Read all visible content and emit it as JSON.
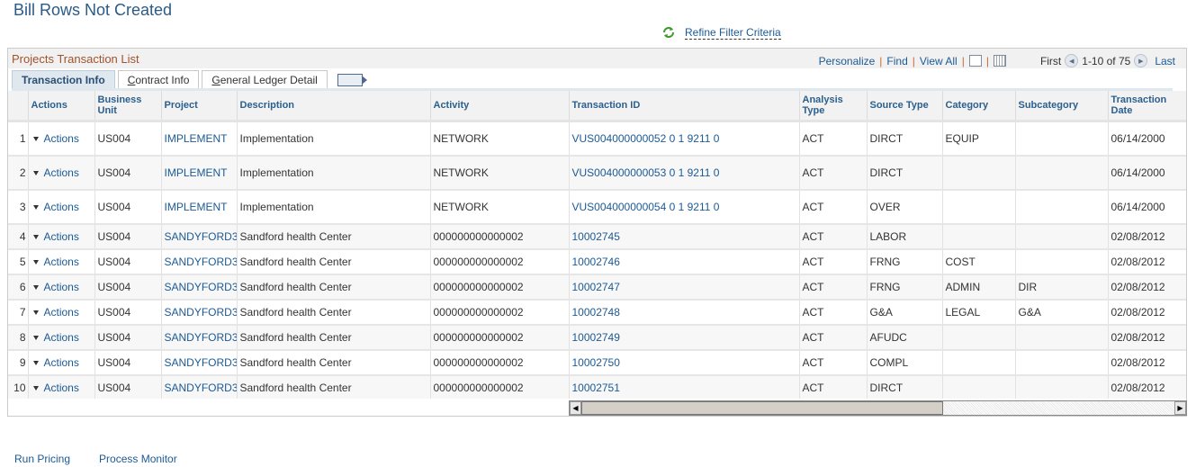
{
  "page": {
    "title": "Bill Rows Not Created"
  },
  "refine": {
    "label": "Refine Filter Criteria",
    "icon": "refresh-icon"
  },
  "grid": {
    "title": "Projects Transaction List",
    "tools": {
      "personalize": "Personalize",
      "find": "Find",
      "view_all": "View All"
    },
    "pager": {
      "first": "First",
      "range": "1-10 of 75",
      "last": "Last"
    },
    "tabs": [
      {
        "label": "Transaction Info",
        "active": true
      },
      {
        "label": "Contract Info",
        "active": false
      },
      {
        "label": "General Ledger Detail",
        "active": false
      }
    ],
    "columns": [
      "",
      "Actions",
      "Business Unit",
      "Project",
      "Description",
      "Activity",
      "Transaction ID",
      "Analysis Type",
      "Source Type",
      "Category",
      "Subcategory",
      "Transaction Date"
    ],
    "rows": [
      {
        "n": "1",
        "action": "Actions",
        "bu": "US004",
        "project": "IMPLEMENT",
        "desc": "Implementation",
        "activity": "NETWORK",
        "txn": "VUS004000000052 0 1 9211 0",
        "analysis": "ACT",
        "source": "DIRCT",
        "category": "EQUIP",
        "subcat": "",
        "date": "06/14/2000"
      },
      {
        "n": "2",
        "action": "Actions",
        "bu": "US004",
        "project": "IMPLEMENT",
        "desc": "Implementation",
        "activity": "NETWORK",
        "txn": "VUS004000000053 0 1 9211 0",
        "analysis": "ACT",
        "source": "DIRCT",
        "category": "",
        "subcat": "",
        "date": "06/14/2000"
      },
      {
        "n": "3",
        "action": "Actions",
        "bu": "US004",
        "project": "IMPLEMENT",
        "desc": "Implementation",
        "activity": "NETWORK",
        "txn": "VUS004000000054 0 1 9211 0",
        "analysis": "ACT",
        "source": "OVER",
        "category": "",
        "subcat": "",
        "date": "06/14/2000"
      },
      {
        "n": "4",
        "action": "Actions",
        "bu": "US004",
        "project": "SANDYFORD3",
        "desc": "Sandford health Center",
        "activity": "000000000000002",
        "txn": "10002745",
        "analysis": "ACT",
        "source": "LABOR",
        "category": "",
        "subcat": "",
        "date": "02/08/2012"
      },
      {
        "n": "5",
        "action": "Actions",
        "bu": "US004",
        "project": "SANDYFORD3",
        "desc": "Sandford health Center",
        "activity": "000000000000002",
        "txn": "10002746",
        "analysis": "ACT",
        "source": "FRNG",
        "category": "COST",
        "subcat": "",
        "date": "02/08/2012"
      },
      {
        "n": "6",
        "action": "Actions",
        "bu": "US004",
        "project": "SANDYFORD3",
        "desc": "Sandford health Center",
        "activity": "000000000000002",
        "txn": "10002747",
        "analysis": "ACT",
        "source": "FRNG",
        "category": "ADMIN",
        "subcat": "DIR",
        "date": "02/08/2012"
      },
      {
        "n": "7",
        "action": "Actions",
        "bu": "US004",
        "project": "SANDYFORD3",
        "desc": "Sandford health Center",
        "activity": "000000000000002",
        "txn": "10002748",
        "analysis": "ACT",
        "source": "G&A",
        "category": "LEGAL",
        "subcat": "G&A",
        "date": "02/08/2012"
      },
      {
        "n": "8",
        "action": "Actions",
        "bu": "US004",
        "project": "SANDYFORD3",
        "desc": "Sandford health Center",
        "activity": "000000000000002",
        "txn": "10002749",
        "analysis": "ACT",
        "source": "AFUDC",
        "category": "",
        "subcat": "",
        "date": "02/08/2012"
      },
      {
        "n": "9",
        "action": "Actions",
        "bu": "US004",
        "project": "SANDYFORD3",
        "desc": "Sandford health Center",
        "activity": "000000000000002",
        "txn": "10002750",
        "analysis": "ACT",
        "source": "COMPL",
        "category": "",
        "subcat": "",
        "date": "02/08/2012"
      },
      {
        "n": "10",
        "action": "Actions",
        "bu": "US004",
        "project": "SANDYFORD3",
        "desc": "Sandford health Center",
        "activity": "000000000000002",
        "txn": "10002751",
        "analysis": "ACT",
        "source": "DIRCT",
        "category": "",
        "subcat": "",
        "date": "02/08/2012"
      }
    ]
  },
  "footer": {
    "run_pricing": "Run Pricing",
    "process_monitor": "Process Monitor"
  }
}
